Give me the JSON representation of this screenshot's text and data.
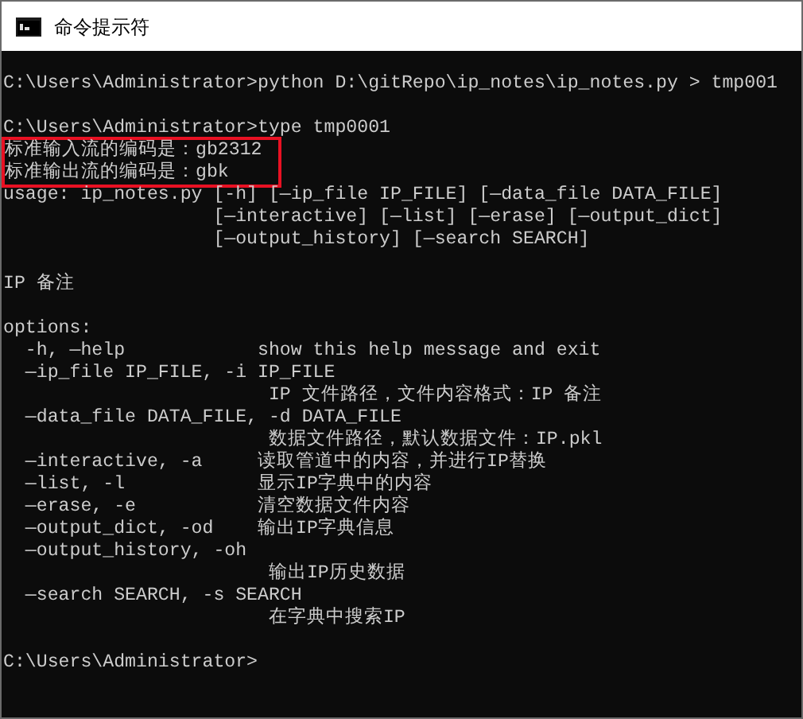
{
  "window": {
    "title": "命令提示符"
  },
  "lines": [
    {
      "kind": "blank"
    },
    {
      "kind": "text",
      "text": "C:\\Users\\Administrator>python D:\\gitRepo\\ip_notes\\ip_notes.py > tmp001",
      "highlighted": false
    },
    {
      "kind": "blank"
    },
    {
      "kind": "text",
      "text": "C:\\Users\\Administrator>type tmp0001",
      "highlighted": false
    },
    {
      "kind": "text",
      "text": "标准输入流的编码是：gb2312",
      "highlighted": true
    },
    {
      "kind": "text",
      "text": "标准输出流的编码是：gbk",
      "highlighted": true
    },
    {
      "kind": "text",
      "text": "usage: ip_notes.py [-h] [—ip_file IP_FILE] [—data_file DATA_FILE]",
      "highlighted": false
    },
    {
      "kind": "text",
      "text": "                   [—interactive] [—list] [—erase] [—output_dict]",
      "highlighted": false
    },
    {
      "kind": "text",
      "text": "                   [—output_history] [—search SEARCH]",
      "highlighted": false
    },
    {
      "kind": "blank"
    },
    {
      "kind": "text",
      "text": "IP 备注",
      "highlighted": false
    },
    {
      "kind": "blank"
    },
    {
      "kind": "text",
      "text": "options:",
      "highlighted": false
    },
    {
      "kind": "text",
      "text": "  -h, —help            show this help message and exit",
      "highlighted": false
    },
    {
      "kind": "text",
      "text": "  —ip_file IP_FILE, -i IP_FILE",
      "highlighted": false
    },
    {
      "kind": "text",
      "text": "                        IP 文件路径，文件内容格式：IP 备注",
      "highlighted": false
    },
    {
      "kind": "text",
      "text": "  —data_file DATA_FILE, -d DATA_FILE",
      "highlighted": false
    },
    {
      "kind": "text",
      "text": "                        数据文件路径，默认数据文件：IP.pkl",
      "highlighted": false
    },
    {
      "kind": "text",
      "text": "  —interactive, -a     读取管道中的内容，并进行IP替换",
      "highlighted": false
    },
    {
      "kind": "text",
      "text": "  —list, -l            显示IP字典中的内容",
      "highlighted": false
    },
    {
      "kind": "text",
      "text": "  —erase, -e           清空数据文件内容",
      "highlighted": false
    },
    {
      "kind": "text",
      "text": "  —output_dict, -od    输出IP字典信息",
      "highlighted": false
    },
    {
      "kind": "text",
      "text": "  —output_history, -oh",
      "highlighted": false
    },
    {
      "kind": "text",
      "text": "                        输出IP历史数据",
      "highlighted": false
    },
    {
      "kind": "text",
      "text": "  —search SEARCH, -s SEARCH",
      "highlighted": false
    },
    {
      "kind": "text",
      "text": "                        在字典中搜索IP",
      "highlighted": false
    },
    {
      "kind": "blank"
    },
    {
      "kind": "text",
      "text": "C:\\Users\\Administrator>",
      "highlighted": false
    }
  ]
}
